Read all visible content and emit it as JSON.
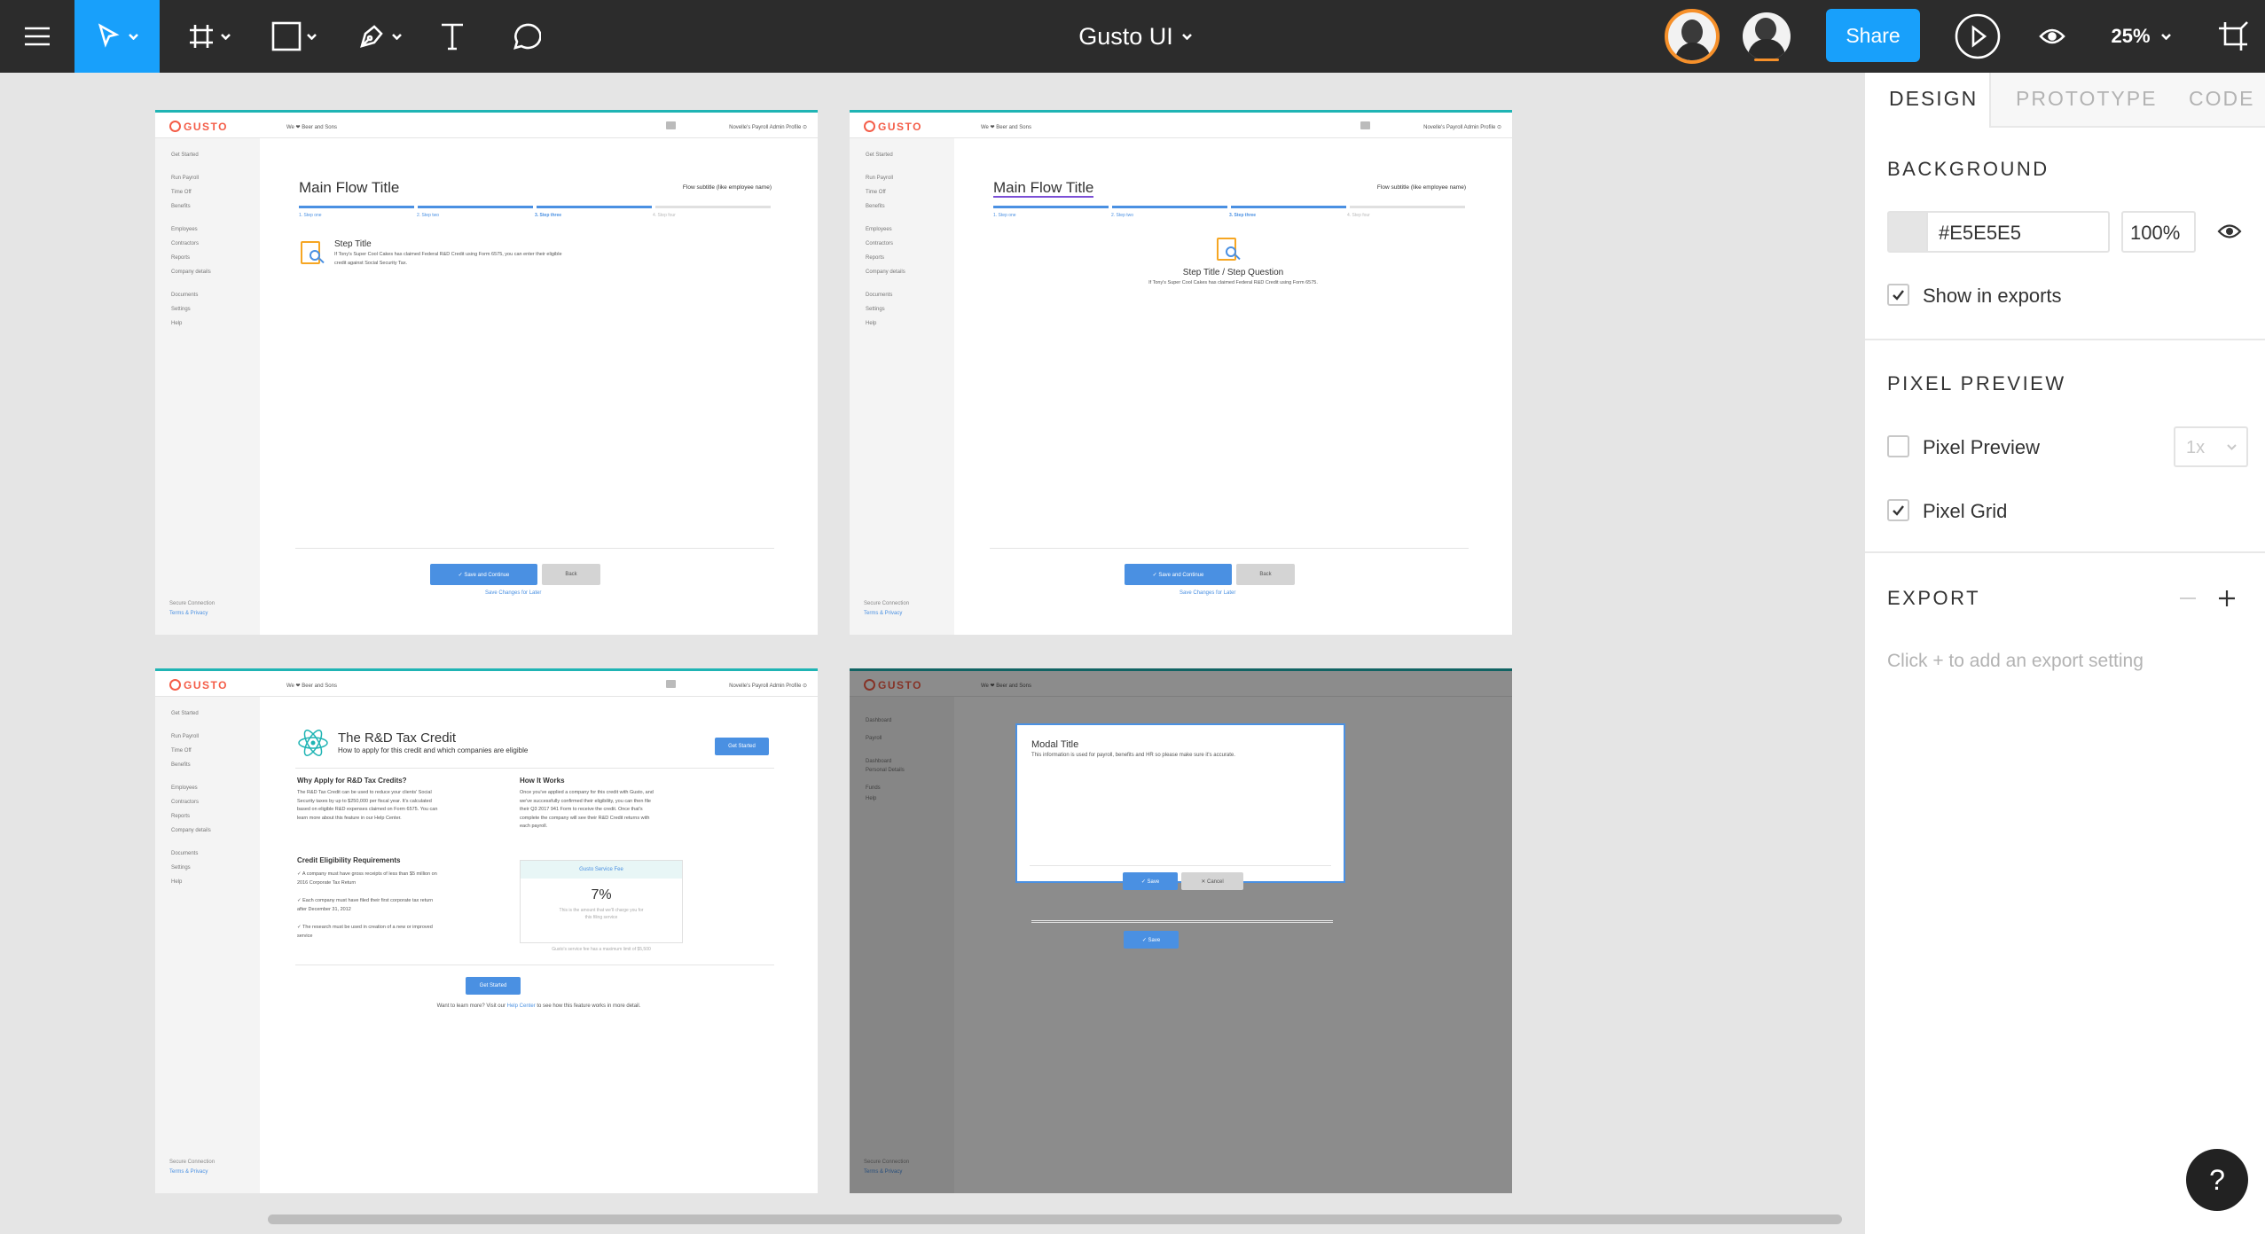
{
  "toolbar": {
    "file_title": "Gusto UI",
    "share_label": "Share",
    "zoom": "25%"
  },
  "panel": {
    "tabs": [
      "DESIGN",
      "PROTOTYPE",
      "CODE"
    ],
    "background_heading": "BACKGROUND",
    "background_hex": "#E5E5E5",
    "background_opacity": "100%",
    "show_in_exports": "Show in exports",
    "pixel_preview_heading": "PIXEL PREVIEW",
    "pixel_preview_label": "Pixel Preview",
    "pixel_preview_scale": "1x",
    "pixel_grid_label": "Pixel Grid",
    "export_heading": "EXPORT",
    "export_hint": "Click + to add an export setting",
    "help": "?"
  },
  "colors": {
    "accent": "#4a90e2",
    "brand": "#f45d48",
    "teal": "#1fb4b4",
    "share": "#18a0fb"
  },
  "gusto": {
    "logo": "GUSTO",
    "company": "We ❤ Beer and Sons",
    "profile": "Novelle's Payroll Admin Profile",
    "nav": [
      "Get Started",
      "Run Payroll",
      "Time Off",
      "Benefits",
      "Employees",
      "Contractors",
      "Reports",
      "Company details",
      "Documents",
      "Settings",
      "Help"
    ],
    "secure": "Secure Connection",
    "terms": "Terms & Privacy"
  },
  "flow1": {
    "title": "Main Flow Title",
    "subtitle": "Flow subtitle (like employee name)",
    "steps": [
      "1. Step one",
      "2. Step two",
      "3. Step three",
      "4. Step four"
    ],
    "step_title": "Step Title",
    "step_text_1": "If Tony's Super Cool Cakes has claimed Federal R&D Credit using Form 6575, you can enter their eligible",
    "step_text_2": "credit against Social Security Tax.",
    "save": "✓ Save and Continue",
    "back": "Back",
    "later": "Save Changes for Later"
  },
  "flow2": {
    "title": "Main Flow Title",
    "subtitle": "Flow subtitle (like employee name)",
    "steps": [
      "1. Step one",
      "2. Step two",
      "3. Step three",
      "4. Step four"
    ],
    "step_title": "Step Title / Step Question",
    "step_text": "If Tony's Super Cool Cakes has claimed Federal R&D Credit using Form 6575.",
    "save": "✓ Save and Continue",
    "back": "Back",
    "later": "Save Changes for Later"
  },
  "rd": {
    "title": "The R&D Tax Credit",
    "subtitle": "How to apply for this credit and which companies are eligible",
    "get_started": "Get Started",
    "why_heading": "Why Apply for R&D Tax Credits?",
    "why_text": [
      "The R&D Tax Credit can be used to reduce your clients' Social",
      "Security taxes by up to $250,000 per fiscal year. It's calculated",
      "based on eligible R&D expenses claimed on Form 6575. You can",
      "learn more about this feature in our Help Center."
    ],
    "how_heading": "How It Works",
    "how_text": [
      "Once you've applied a company for this credit with Gusto, and",
      "we've successfully confirmed their eligibility, you can then file",
      "their Q3 2017 941 Form to receive the credit. Once that's",
      "complete the company will see their R&D Credit returns with",
      "each payroll."
    ],
    "req_heading": "Credit Eligibility Requirements",
    "reqs": [
      [
        "✓ A company must have gross receipts of less than $5 million on",
        "2016 Corporate Tax Return"
      ],
      [
        "✓ Each company must have filed their first corporate tax return",
        "after December 31, 2012"
      ],
      [
        "✓ The research must be used in creation of a new or improved",
        "service"
      ]
    ],
    "fee_heading": "Gusto Service Fee",
    "fee_value": "7%",
    "fee_text_1": "This is the amount that we'll charge you for",
    "fee_text_2": "this filing service",
    "fee_note": "Gusto's service fee has a maximum limit of $5,500",
    "learn_more_pre": "Want to learn more? Visit our",
    "learn_more_link": "Help Center",
    "learn_more_post": "to see how this feature works in more detail."
  },
  "modal": {
    "title": "Modal Title",
    "text": "This information is used for payroll, benefits and HR so please make sure it's accurate.",
    "save": "✓ Save",
    "cancel": "✕ Cancel",
    "nav": [
      "Dashboard",
      "Payroll",
      "Dashboard",
      "Personal Details",
      "Funds",
      "Help"
    ]
  }
}
